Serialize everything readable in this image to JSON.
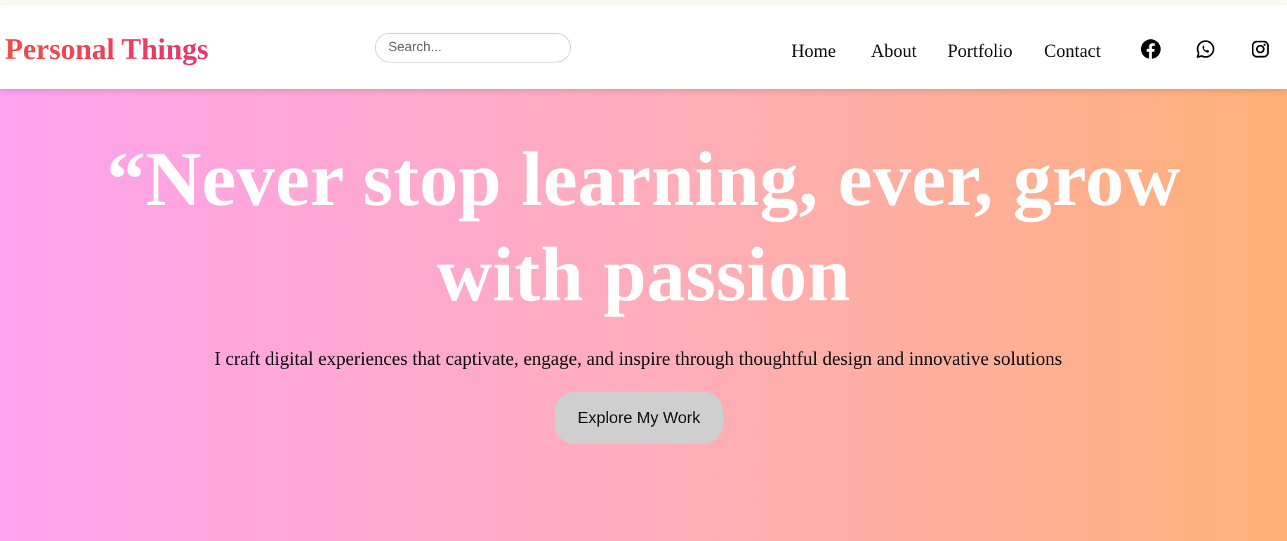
{
  "header": {
    "logo": "Personal Things",
    "search": {
      "placeholder": "Search...",
      "value": ""
    },
    "nav": [
      "Home",
      "About",
      "Portfolio",
      "Contact"
    ],
    "social": [
      "facebook-icon",
      "whatsapp-icon",
      "instagram-icon"
    ]
  },
  "hero": {
    "quote_line1": "“Never stop learning, ever, grow",
    "quote_line2": "with passion",
    "subtitle": "I craft digital experiences that captivate, engage, and inspire through thoughtful design and innovative solutions",
    "cta": "Explore My Work"
  },
  "colors": {
    "logo_gradient_start": "#ef4f47",
    "logo_gradient_end": "#e6386f",
    "hero_gradient_start": "#ffa3ef",
    "hero_gradient_mid": "#ffadbd",
    "hero_gradient_end": "#ffb077",
    "cta_background": "#cfcfcf",
    "quote_text": "#ffffff"
  }
}
